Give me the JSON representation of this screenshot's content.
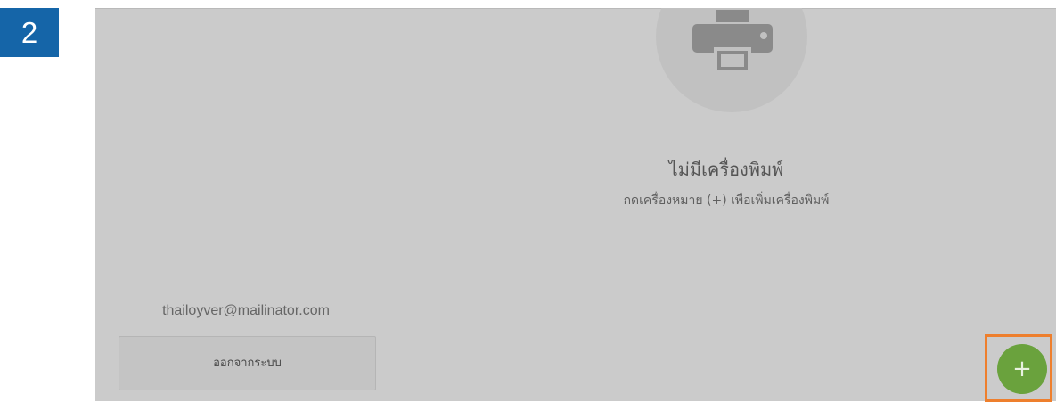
{
  "step": {
    "number": "2",
    "badge_color": "#1565a8"
  },
  "sidebar": {
    "email": "thailoyver@mailinator.com",
    "logout_label": "ออกจากระบบ"
  },
  "main": {
    "empty_state_icon": "printer-icon",
    "empty_title": "ไม่มีเครื่องพิมพ์",
    "empty_hint": "กดเครื่องหมาย (+) เพื่อเพิ่มเครื่องพิมพ์"
  },
  "fab": {
    "icon": "+",
    "color": "#6aa23d",
    "highlight_color": "#ee7f2d"
  },
  "colors": {
    "background": "#cbcbcb"
  }
}
